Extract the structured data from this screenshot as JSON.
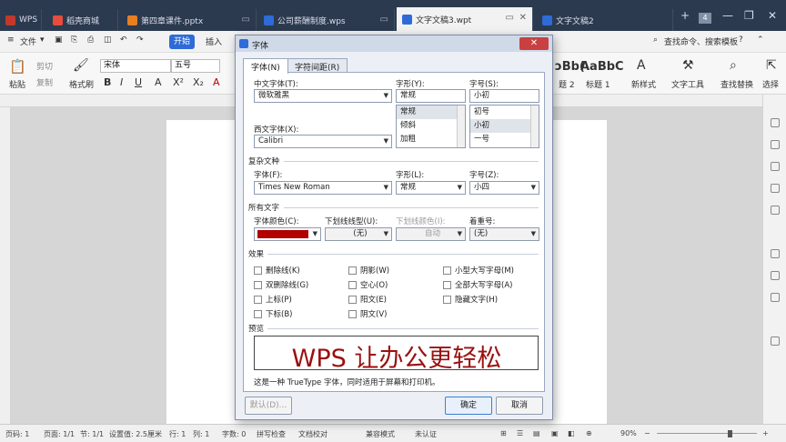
{
  "tabs": [
    {
      "label": "WPS",
      "color": "#c0392b"
    },
    {
      "label": "稻壳商城",
      "color": "#e74c3c"
    },
    {
      "label": "第四章课件.pptx",
      "color": "#e67e22"
    },
    {
      "label": "公司薪酬制度.wps",
      "color": "#2f6bd8"
    },
    {
      "label": "文字文稿3.wpt",
      "color": "#2f6bd8"
    },
    {
      "label": "文字文稿2",
      "color": "#2f6bd8"
    }
  ],
  "window": {
    "add_tab": "+",
    "tab_count": "4"
  },
  "menu": {
    "file": "文件",
    "start": "开始",
    "insert": "插入",
    "search": "查找命令、搜索模板",
    "help": "?"
  },
  "ribbon": {
    "paste": "粘贴",
    "cut": "剪切",
    "copy": "复制",
    "format_painter": "格式刷",
    "font_name": "宋体",
    "font_size": "五号",
    "style_preview": "AaBbC",
    "heading1": "标题 1",
    "heading2_prefix": "ɔBb(",
    "heading2": "题 2",
    "new_style": "新样式",
    "text_tools": "文字工具",
    "find_replace": "查找替换",
    "select": "选择"
  },
  "dialog": {
    "title": "字体",
    "tab_font": "字体(N)",
    "tab_spacing": "字符间距(R)",
    "cn_font_label": "中文字体(T):",
    "cn_font_value": "微软雅黑",
    "style_label": "字形(Y):",
    "style_value": "常规",
    "style_options": [
      "常规",
      "倾斜",
      "加粗"
    ],
    "size_label": "字号(S):",
    "size_value": "小初",
    "size_options": [
      "初号",
      "小初",
      "一号"
    ],
    "west_font_label": "西文字体(X):",
    "west_font_value": "Calibri",
    "complex_section": "复杂文种",
    "complex_font_label": "字体(F):",
    "complex_font_value": "Times New Roman",
    "complex_style_label": "字形(L):",
    "complex_style_value": "常规",
    "complex_size_label": "字号(Z):",
    "complex_size_value": "小四",
    "all_text_section": "所有文字",
    "color_label": "字体颜色(C):",
    "font_color": "#b00000",
    "underline_label": "下划线线型(U):",
    "underline_value": "(无)",
    "underline_color_label": "下划线颜色(I):",
    "underline_color_value": "自动",
    "emphasis_label": "着重号:",
    "emphasis_value": "(无)",
    "effects_section": "效果",
    "effects": {
      "strike": "删除线(K)",
      "double_strike": "双删除线(G)",
      "superscript": "上标(P)",
      "subscript": "下标(B)",
      "shadow": "阴影(W)",
      "outline": "空心(O)",
      "emboss": "阳文(E)",
      "engrave": "阴文(V)",
      "small_caps": "小型大写字母(M)",
      "all_caps": "全部大写字母(A)",
      "hidden": "隐藏文字(H)"
    },
    "preview_section": "预览",
    "preview_text": "WPS 让办公更轻松",
    "preview_note": "这是一种 TrueType 字体，同时适用于屏幕和打印机。",
    "default_btn": "默认(D)...",
    "ok_btn": "确定",
    "cancel_btn": "取消"
  },
  "status": {
    "page": "页码: 1",
    "pages": "页面: 1/1",
    "section": "节: 1/1",
    "setting": "设置值: 2.5厘米",
    "row": "行: 1",
    "col": "列: 1",
    "words": "字数: 0",
    "spell": "拼写检查",
    "proof": "文档校对",
    "compat": "兼容模式",
    "cert": "未认证",
    "zoom": "90%"
  }
}
